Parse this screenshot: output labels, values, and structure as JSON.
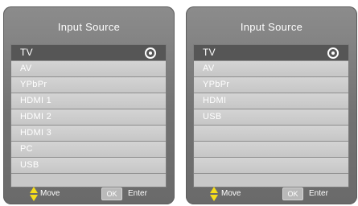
{
  "colors": {
    "panel_bg": "#727272",
    "list_bg": "#c8c8c8",
    "selected_row_bg": "#565656",
    "move_icon": "#f4dc1c"
  },
  "left_panel": {
    "title": "Input Source",
    "items": [
      {
        "label": "TV"
      },
      {
        "label": "AV"
      },
      {
        "label": "YPbPr"
      },
      {
        "label": "HDMI 1"
      },
      {
        "label": "HDMI 2"
      },
      {
        "label": "HDMI 3"
      },
      {
        "label": "PC"
      },
      {
        "label": "USB"
      }
    ],
    "selected_index": 0,
    "footer": {
      "move_icon": "up-down-arrow-icon",
      "move_label": "Move",
      "ok_label": "OK",
      "enter_label": "Enter"
    }
  },
  "right_panel": {
    "title": "Input Source",
    "items": [
      {
        "label": "TV"
      },
      {
        "label": "AV"
      },
      {
        "label": "YPbPr"
      },
      {
        "label": "HDMI"
      },
      {
        "label": "USB"
      },
      {
        "label": ""
      },
      {
        "label": ""
      },
      {
        "label": ""
      }
    ],
    "selected_index": 0,
    "footer": {
      "move_icon": "up-down-arrow-icon",
      "move_label": "Move",
      "ok_label": "OK",
      "enter_label": "Enter"
    }
  }
}
